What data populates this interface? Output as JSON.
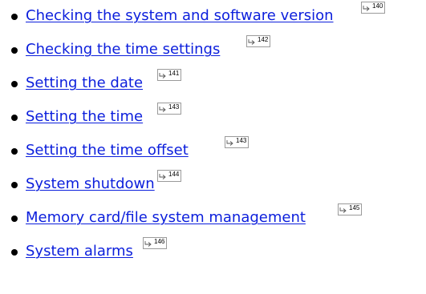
{
  "links": [
    {
      "label": "Checking the system and software version",
      "page_ref": "140"
    },
    {
      "label": "Checking the time settings",
      "page_ref": "142"
    },
    {
      "label": "Setting the date",
      "page_ref": "141"
    },
    {
      "label": "Setting the time",
      "page_ref": "143"
    },
    {
      "label": "Setting the time offset",
      "page_ref": "143"
    },
    {
      "label": "System shutdown",
      "page_ref": "144"
    },
    {
      "label": "Memory card/file system management",
      "page_ref": "145"
    },
    {
      "label": "System alarms",
      "page_ref": "146"
    }
  ],
  "colors": {
    "link": "#0b1edc",
    "bullet": "#000000",
    "ref_border": "#9a9a9a"
  },
  "icons": {
    "page_ref_arrow": "page-reference-arrow-icon"
  }
}
